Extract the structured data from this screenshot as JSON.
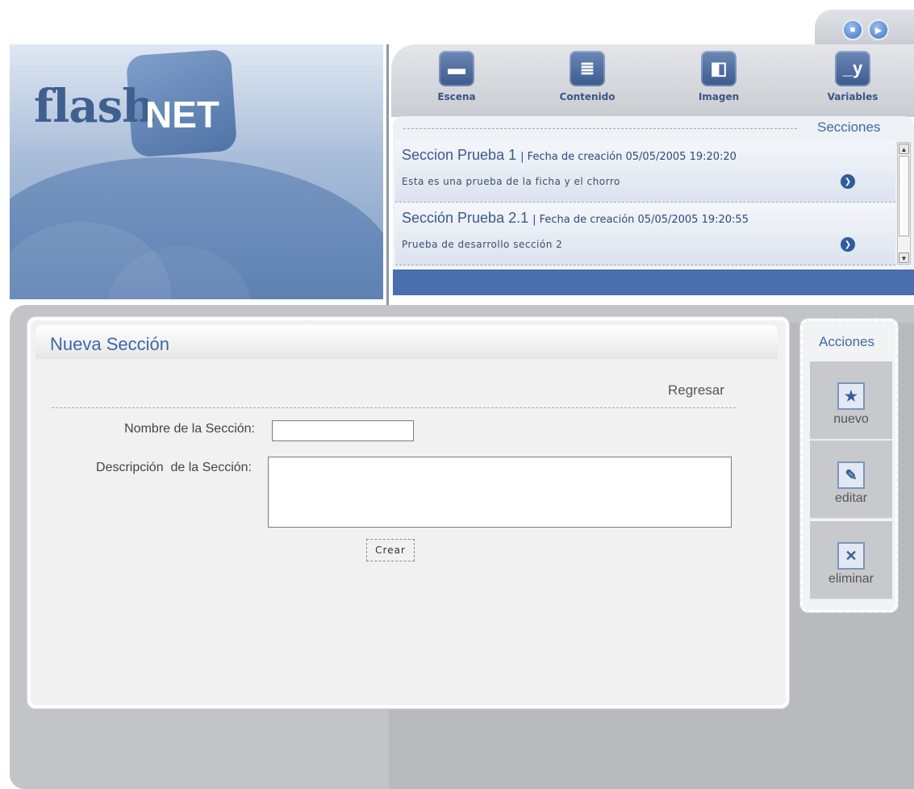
{
  "logo": {
    "part1": "flash",
    "part2": "NET"
  },
  "window_buttons": {
    "stop_icon": "stop-icon",
    "play_icon": "play-icon"
  },
  "toolbar": {
    "items": [
      {
        "label": "Escena",
        "icon": "clapperboard-icon",
        "glyph": "▬"
      },
      {
        "label": "Contenido",
        "icon": "document-icon",
        "glyph": "≣"
      },
      {
        "label": "Imagen",
        "icon": "image-icon",
        "glyph": "◧"
      },
      {
        "label": "Variables",
        "icon": "variable-y-icon",
        "glyph": "_y"
      }
    ]
  },
  "sections_list": {
    "title": "Secciones",
    "items": [
      {
        "name": "Seccion Prueba 1",
        "date": "| Fecha de creación 05/05/2005 19:20:20",
        "description": "Esta es una prueba de la ficha y el chorro"
      },
      {
        "name": "Sección Prueba 2.1",
        "date": "| Fecha de creación 05/05/2005 19:20:55",
        "description": "Prueba de desarrollo sección 2"
      }
    ]
  },
  "form": {
    "title": "Nueva Sección",
    "back_link": "Regresar",
    "name_label": "Nombre de la Sección:",
    "name_value": "",
    "description_label": "Descripción  de la Sección:",
    "description_value": "",
    "submit_label": "Crear"
  },
  "actions": {
    "title": "Acciones",
    "items": [
      {
        "label": "nuevo",
        "icon": "new-document-icon",
        "glyph": "★"
      },
      {
        "label": "editar",
        "icon": "edit-document-icon",
        "glyph": "✎"
      },
      {
        "label": "eliminar",
        "icon": "delete-document-icon",
        "glyph": "✕"
      }
    ]
  },
  "colors": {
    "accent": "#3d6aa8",
    "bar": "#4b6eaf",
    "panel": "#f1f1f1"
  }
}
